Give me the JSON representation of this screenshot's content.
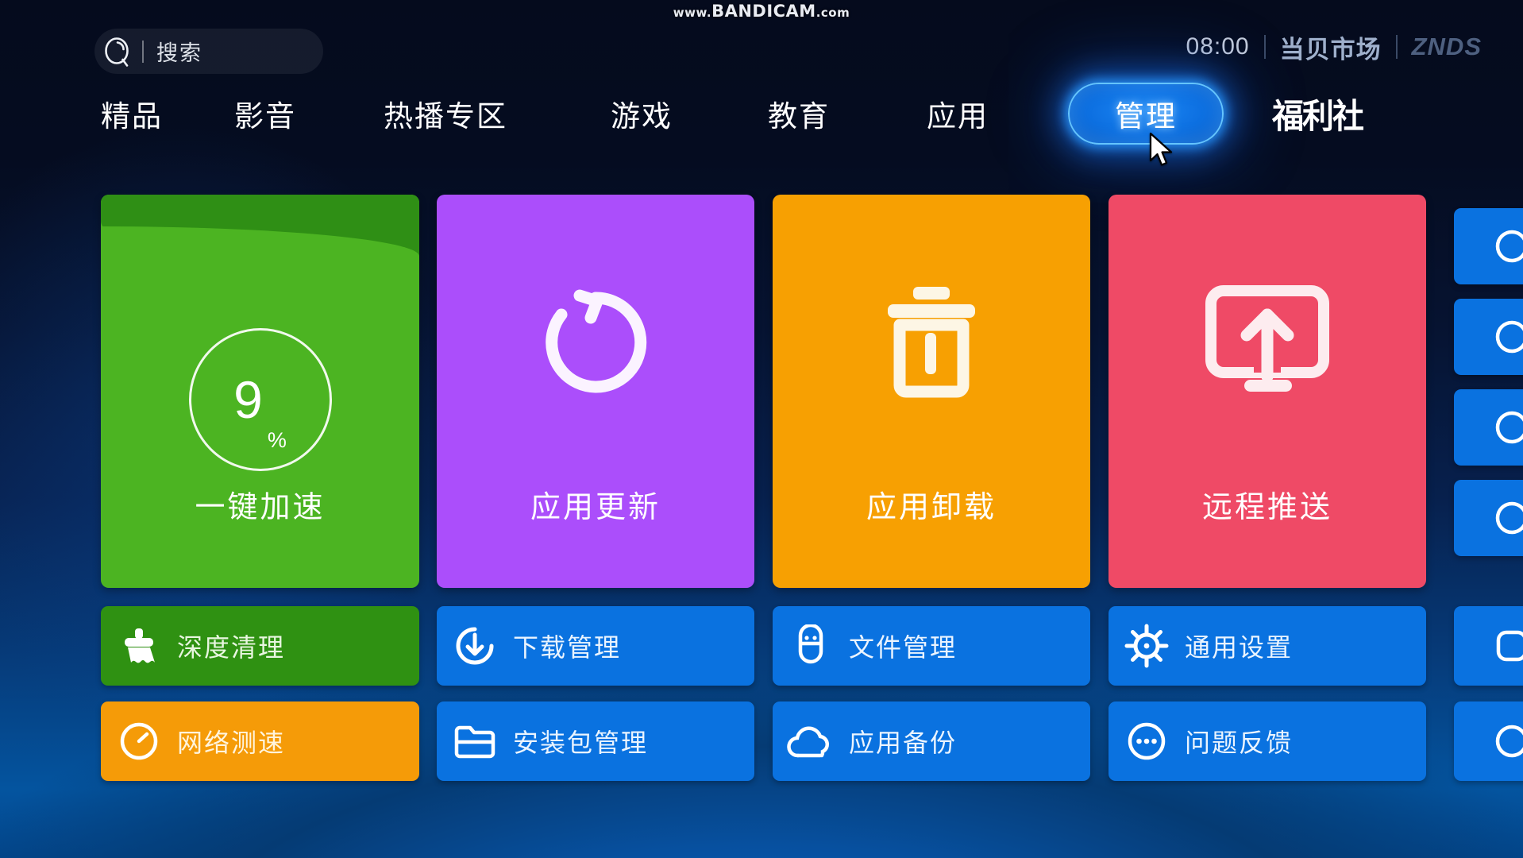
{
  "watermark": {
    "prefix": "www.",
    "main": "BANDICAM",
    "suffix": ".com"
  },
  "topbar": {
    "search_placeholder": "搜索",
    "search_icon": "search-icon",
    "clock": "08:00",
    "brand_cn": "当贝市场",
    "brand_en": "ZNDS"
  },
  "nav": {
    "items": [
      {
        "label": "精品",
        "selected": false
      },
      {
        "label": "影音",
        "selected": false
      },
      {
        "label": "热播专区",
        "selected": false
      },
      {
        "label": "游戏",
        "selected": false
      },
      {
        "label": "教育",
        "selected": false
      },
      {
        "label": "应用",
        "selected": false
      },
      {
        "label": "管理",
        "selected": true
      }
    ],
    "promo_label": "福利社"
  },
  "cards": {
    "accelerate": {
      "label": "一键加速",
      "value": "9",
      "unit": "%",
      "color": "#4cb422",
      "icon": "gauge-ring-icon"
    },
    "update": {
      "label": "应用更新",
      "color": "#ab4efb",
      "icon": "refresh-circle-icon"
    },
    "uninstall": {
      "label": "应用卸载",
      "color": "#f7a002",
      "icon": "trash-icon"
    },
    "push": {
      "label": "远程推送",
      "color": "#ef4a66",
      "icon": "screen-upload-icon"
    }
  },
  "buttons": {
    "row1": [
      {
        "label": "深度清理",
        "icon": "broom-icon",
        "style": "green"
      },
      {
        "label": "下载管理",
        "icon": "download-icon",
        "style": "blue"
      },
      {
        "label": "文件管理",
        "icon": "usb-drive-icon",
        "style": "blue"
      },
      {
        "label": "通用设置",
        "icon": "gear-icon",
        "style": "blue"
      }
    ],
    "row2": [
      {
        "label": "网络测速",
        "icon": "speedometer-icon",
        "style": "orange"
      },
      {
        "label": "安装包管理",
        "icon": "folder-icon",
        "style": "blue"
      },
      {
        "label": "应用备份",
        "icon": "cloud-icon",
        "style": "blue"
      },
      {
        "label": "问题反馈",
        "icon": "dots-circle-icon",
        "style": "blue"
      }
    ]
  },
  "edge_column": {
    "note": "partially visible blue buttons at right edge",
    "count": 6
  },
  "colors": {
    "accent_blue": "#0a72e0",
    "selected_glow": "#1a86f5",
    "background_top": "#050b1d",
    "background_bottom": "#04549f"
  },
  "cursor": {
    "icon": "arrow-pointer-icon"
  }
}
